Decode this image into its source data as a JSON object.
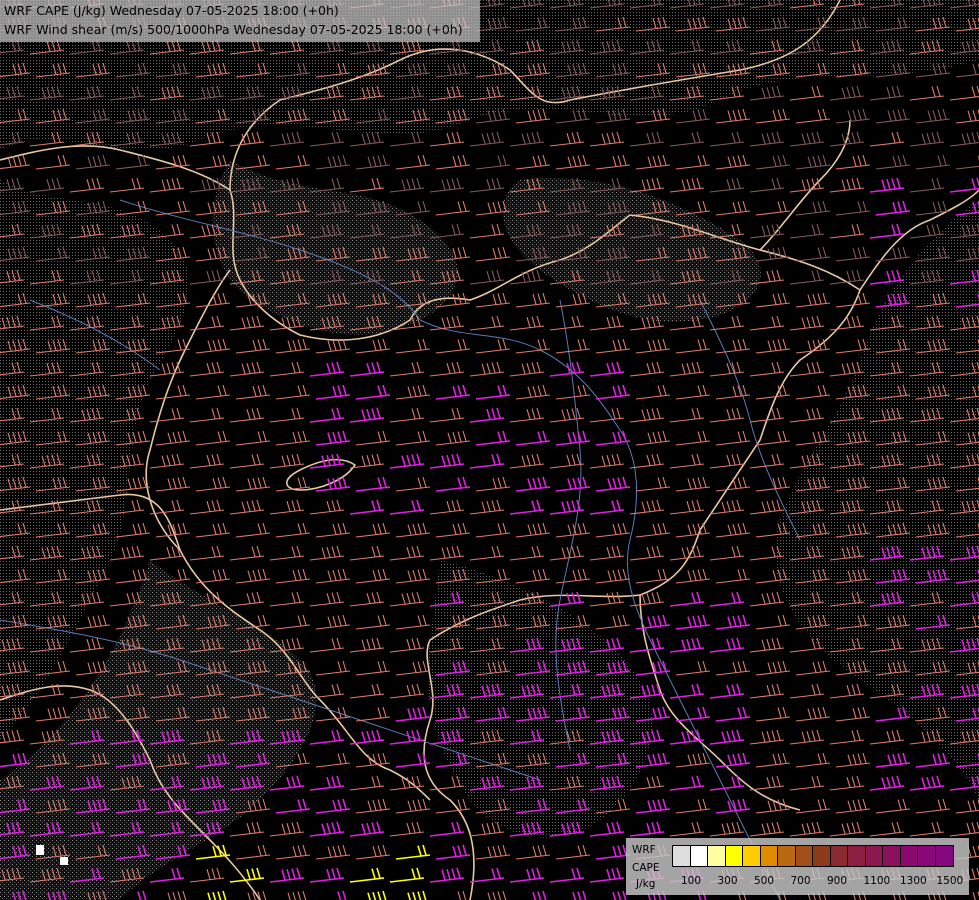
{
  "header": {
    "line1": "WRF CAPE (J/kg) Wednesday 07-05-2025 18:00 (+0h)",
    "line2": "WRF Wind shear (m/s) 500/1000hPa Wednesday 07-05-2025 18:00 (+0h)"
  },
  "legend": {
    "label_model": "WRF",
    "label_field": "CAPE",
    "label_unit": "J/kg",
    "colors": [
      "#dddddd",
      "#ffffff",
      "#ffffa0",
      "#ffff00",
      "#ffcc00",
      "#e08c00",
      "#b86a10",
      "#a05018",
      "#8c3a1c",
      "#8a2a30",
      "#8c2040",
      "#8c1850",
      "#8c1060",
      "#8a0870",
      "#880878",
      "#860880"
    ],
    "ticks": [
      "100",
      "300",
      "500",
      "700",
      "900",
      "1100",
      "1300",
      "1500"
    ]
  },
  "map": {
    "background_color": "#000000",
    "border_color": "#e8c8a0",
    "river_color": "#5a7ab8",
    "contour_color": "#c8c8c8",
    "barb_colors": {
      "low": "#8a5a5a",
      "mid": "#e07c6c",
      "high": "#e020e0",
      "yellow": "#ffff00"
    }
  }
}
